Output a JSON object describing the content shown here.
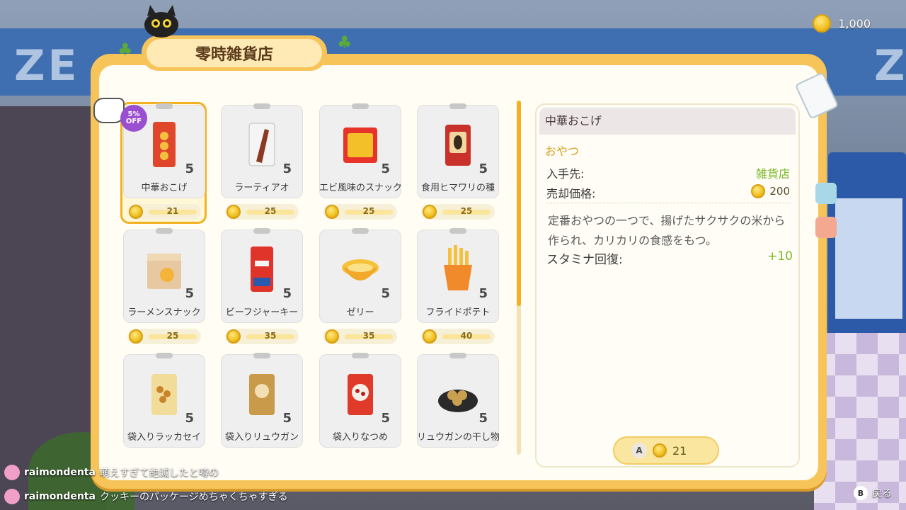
{
  "top_bar": {
    "coins": "1,000"
  },
  "shop": {
    "title": "零時雑貨店",
    "discount_badge": {
      "line1": "5%",
      "line2": "OFF"
    },
    "items": [
      {
        "name": "中華おこげ",
        "qty": "5",
        "price": "21",
        "selected": true
      },
      {
        "name": "ラーティアオ",
        "qty": "5",
        "price": "25"
      },
      {
        "name": "エビ風味のスナック",
        "qty": "5",
        "price": "25"
      },
      {
        "name": "食用ヒマワリの種",
        "qty": "5",
        "price": "25"
      },
      {
        "name": "ラーメンスナック",
        "qty": "5",
        "price": "25"
      },
      {
        "name": "ビーフジャーキー",
        "qty": "5",
        "price": "35"
      },
      {
        "name": "ゼリー",
        "qty": "5",
        "price": "35"
      },
      {
        "name": "フライドポテト",
        "qty": "5",
        "price": "40"
      },
      {
        "name": "袋入りラッカセイ",
        "qty": "5",
        "price": ""
      },
      {
        "name": "袋入りリュウガン",
        "qty": "5",
        "price": ""
      },
      {
        "name": "袋入りなつめ",
        "qty": "5",
        "price": ""
      },
      {
        "name": "リュウガンの干し物",
        "qty": "5",
        "price": ""
      }
    ]
  },
  "detail": {
    "title": "中華おこげ",
    "category": "おやつ",
    "source_label": "入手先:",
    "source_value": "雑貨店",
    "sell_label": "売却価格:",
    "sell_value": "200",
    "description": "定番おやつの一つで、揚げたサクサクの米から作られ、カリカリの食感をもつ。",
    "stamina_label": "スタミナ回復:",
    "stamina_value": "+10"
  },
  "buy_button": {
    "key": "A",
    "price": "21"
  },
  "chat": [
    {
      "user": "raimondenta",
      "message": "萌えすぎて絶滅したと噂の"
    },
    {
      "user": "raimondenta",
      "message": "クッキーのパッケージめちゃくちゃすぎる"
    }
  ],
  "back_button": {
    "key": "B",
    "label": "戻る"
  }
}
